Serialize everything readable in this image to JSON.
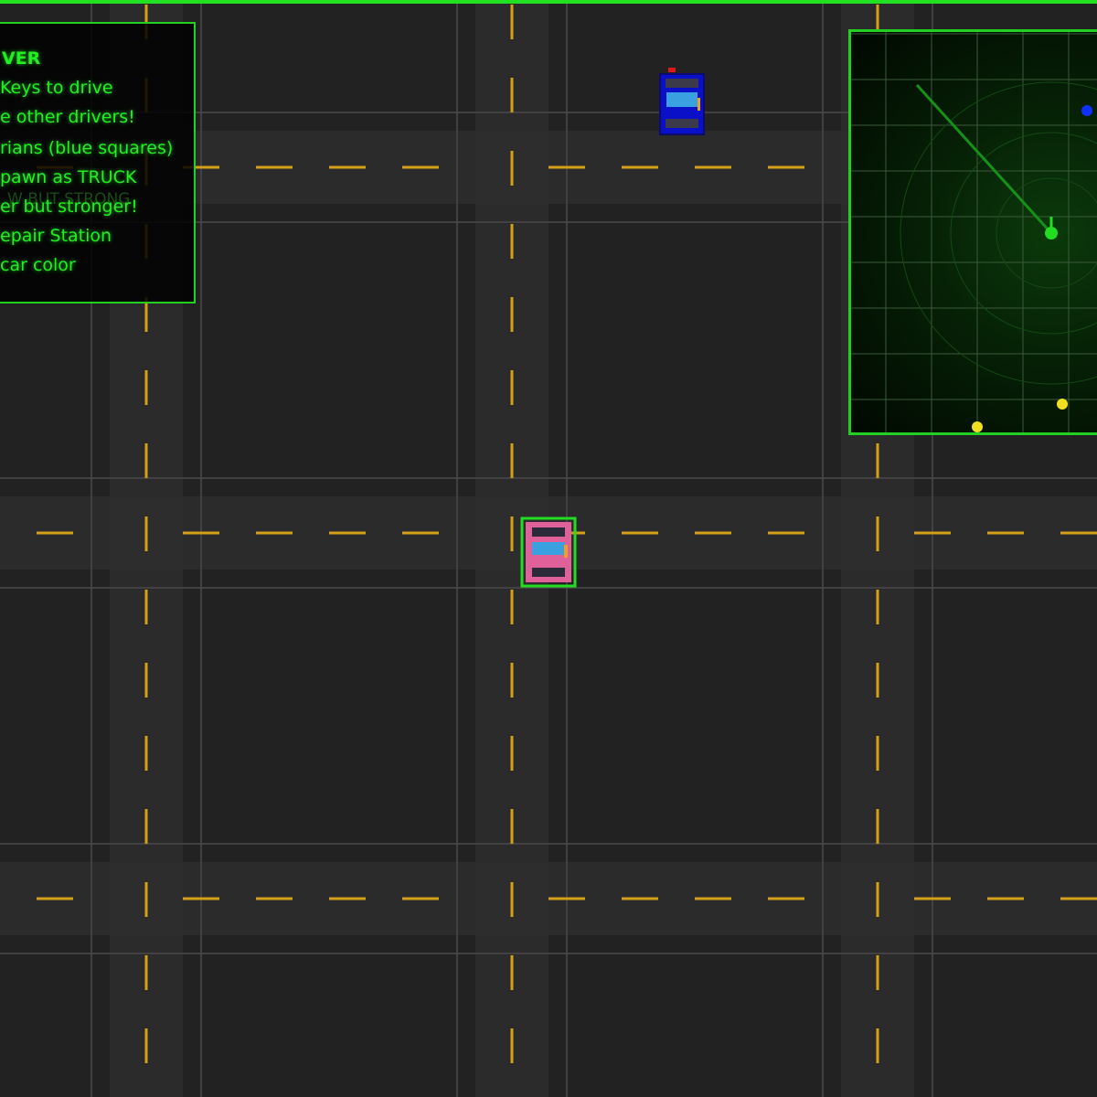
{
  "hud": {
    "instructions": {
      "title": "VER",
      "lines": [
        "Keys to drive",
        "e other drivers!",
        "rians (blue squares)",
        "pawn as TRUCK",
        "er but stronger!",
        "epair Station",
        "car color"
      ],
      "ghost_line": "W BUT STRONG"
    }
  },
  "colors": {
    "ground": "#222222",
    "road": "#2b2b2b",
    "lane_marking": "#d4a017",
    "hud_green": "#22ee22",
    "player_body": "#e0609a",
    "player_highlight": "#22dd22",
    "npc_body": "#0a10c8",
    "window": "#3aa0e0",
    "radar_yellow": "#f0e020",
    "radar_blue": "#1030ff"
  },
  "entities": {
    "player_car": {
      "type": "car",
      "color": "pink",
      "selected": true
    },
    "npc_car": {
      "type": "car",
      "color": "blue",
      "siren": "red"
    }
  },
  "minimap": {
    "icons": [
      "player-dot",
      "yellow-dot",
      "yellow-dot",
      "blue-dot"
    ]
  }
}
